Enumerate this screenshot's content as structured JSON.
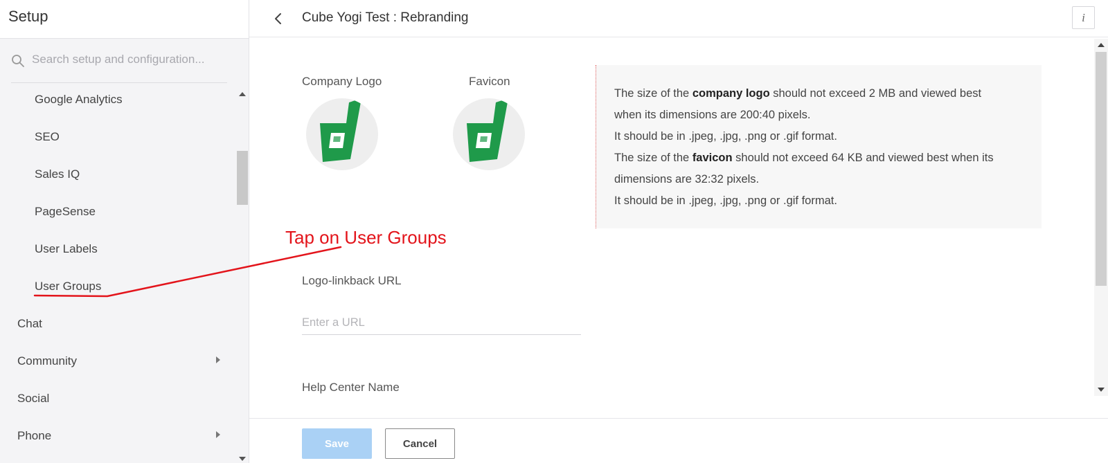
{
  "sidebar": {
    "title": "Setup",
    "search_placeholder": "Search setup and configuration...",
    "sub_items": [
      "Google Analytics",
      "SEO",
      "Sales IQ",
      "PageSense",
      "User Labels",
      "User Groups"
    ],
    "top_items": [
      {
        "label": "Chat",
        "has_submenu": false
      },
      {
        "label": "Community",
        "has_submenu": true
      },
      {
        "label": "Social",
        "has_submenu": false
      },
      {
        "label": "Phone",
        "has_submenu": true
      }
    ]
  },
  "header": {
    "title": "Cube Yogi Test : Rebranding",
    "info_label": "i"
  },
  "logos": {
    "company_logo_label": "Company Logo",
    "favicon_label": "Favicon",
    "logo_icon": "green-d-logo",
    "logo_color": "#1f9a4a"
  },
  "info": {
    "lines": [
      {
        "pre": "The size of the ",
        "bold": "company logo",
        "post": " should not exceed 2 MB and viewed best"
      },
      {
        "pre": "when its dimensions are 200:40 pixels.",
        "bold": "",
        "post": ""
      },
      {
        "pre": "It should be in .jpeg, .jpg, .png or .gif format.",
        "bold": "",
        "post": ""
      },
      {
        "pre": "The size of the ",
        "bold": "favicon",
        "post": " should not exceed 64 KB and viewed best when its"
      },
      {
        "pre": "dimensions are 32:32 pixels.",
        "bold": "",
        "post": ""
      },
      {
        "pre": "It should be in .jpeg, .jpg, .png or .gif format.",
        "bold": "",
        "post": ""
      }
    ]
  },
  "form": {
    "linkback_label": "Logo-linkback URL",
    "url_placeholder": "Enter a URL",
    "url_value": "",
    "help_center_label": "Help Center Name"
  },
  "footer": {
    "save_label": "Save",
    "cancel_label": "Cancel"
  },
  "annotation": {
    "text": "Tap on User Groups",
    "color": "#e3141b"
  },
  "colors": {
    "save_button": "#aad1f5",
    "sidebar_bg": "#f4f4f6"
  }
}
